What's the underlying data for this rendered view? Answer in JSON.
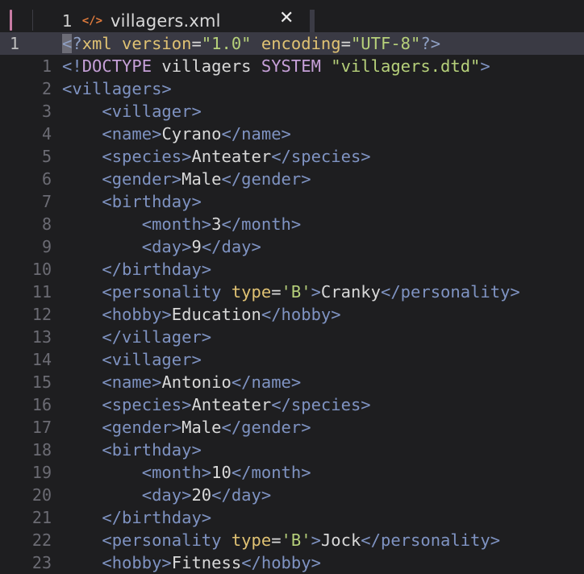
{
  "tab": {
    "number": "1",
    "icon": "</>",
    "filename": "villagers.xml",
    "close_glyph": "✕"
  },
  "editor": {
    "active_line_label": "1",
    "lines": [
      {
        "num": "1",
        "active": true,
        "tokens": [
          {
            "t": "t-pi",
            "v": "<?"
          },
          {
            "t": "t-attr",
            "v": "xml version"
          },
          {
            "t": "t-text",
            "v": "="
          },
          {
            "t": "t-str",
            "v": "\"1.0\""
          },
          {
            "t": "t-text",
            "v": " "
          },
          {
            "t": "t-attr",
            "v": "encoding"
          },
          {
            "t": "t-text",
            "v": "="
          },
          {
            "t": "t-str",
            "v": "\"UTF-8\""
          },
          {
            "t": "t-pi",
            "v": "?>"
          }
        ]
      },
      {
        "num": "1",
        "tokens": [
          {
            "t": "t-tag",
            "v": "<!"
          },
          {
            "t": "t-doctype",
            "v": "DOCTYPE"
          },
          {
            "t": "t-text",
            "v": " villagers "
          },
          {
            "t": "t-doctype",
            "v": "SYSTEM"
          },
          {
            "t": "t-text",
            "v": " "
          },
          {
            "t": "t-str",
            "v": "\"villagers.dtd\""
          },
          {
            "t": "t-tag",
            "v": ">"
          }
        ]
      },
      {
        "num": "2",
        "tokens": [
          {
            "t": "t-tag",
            "v": "<villagers>"
          }
        ]
      },
      {
        "num": "3",
        "tokens": [
          {
            "t": "t-text",
            "v": "    "
          },
          {
            "t": "t-tag",
            "v": "<villager>"
          }
        ]
      },
      {
        "num": "4",
        "tokens": [
          {
            "t": "t-text",
            "v": "    "
          },
          {
            "t": "t-tag",
            "v": "<name>"
          },
          {
            "t": "t-text",
            "v": "Cyrano"
          },
          {
            "t": "t-tag",
            "v": "</name>"
          }
        ]
      },
      {
        "num": "5",
        "tokens": [
          {
            "t": "t-text",
            "v": "    "
          },
          {
            "t": "t-tag",
            "v": "<species>"
          },
          {
            "t": "t-text",
            "v": "Anteater"
          },
          {
            "t": "t-tag",
            "v": "</species>"
          }
        ]
      },
      {
        "num": "6",
        "tokens": [
          {
            "t": "t-text",
            "v": "    "
          },
          {
            "t": "t-tag",
            "v": "<gender>"
          },
          {
            "t": "t-text",
            "v": "Male"
          },
          {
            "t": "t-tag",
            "v": "</gender>"
          }
        ]
      },
      {
        "num": "7",
        "tokens": [
          {
            "t": "t-text",
            "v": "    "
          },
          {
            "t": "t-tag",
            "v": "<birthday>"
          }
        ]
      },
      {
        "num": "8",
        "tokens": [
          {
            "t": "t-text",
            "v": "        "
          },
          {
            "t": "t-tag",
            "v": "<month>"
          },
          {
            "t": "t-text",
            "v": "3"
          },
          {
            "t": "t-tag",
            "v": "</month>"
          }
        ]
      },
      {
        "num": "9",
        "tokens": [
          {
            "t": "t-text",
            "v": "        "
          },
          {
            "t": "t-tag",
            "v": "<day>"
          },
          {
            "t": "t-text",
            "v": "9"
          },
          {
            "t": "t-tag",
            "v": "</day>"
          }
        ]
      },
      {
        "num": "10",
        "tokens": [
          {
            "t": "t-text",
            "v": "    "
          },
          {
            "t": "t-tag",
            "v": "</birthday>"
          }
        ]
      },
      {
        "num": "11",
        "tokens": [
          {
            "t": "t-text",
            "v": "    "
          },
          {
            "t": "t-tag",
            "v": "<personality "
          },
          {
            "t": "t-attr",
            "v": "type"
          },
          {
            "t": "t-text",
            "v": "="
          },
          {
            "t": "t-str",
            "v": "'B'"
          },
          {
            "t": "t-tag",
            "v": ">"
          },
          {
            "t": "t-text",
            "v": "Cranky"
          },
          {
            "t": "t-tag",
            "v": "</personality>"
          }
        ]
      },
      {
        "num": "12",
        "tokens": [
          {
            "t": "t-text",
            "v": "    "
          },
          {
            "t": "t-tag",
            "v": "<hobby>"
          },
          {
            "t": "t-text",
            "v": "Education"
          },
          {
            "t": "t-tag",
            "v": "</hobby>"
          }
        ]
      },
      {
        "num": "13",
        "tokens": [
          {
            "t": "t-text",
            "v": "    "
          },
          {
            "t": "t-tag",
            "v": "</villager>"
          }
        ]
      },
      {
        "num": "14",
        "tokens": [
          {
            "t": "t-text",
            "v": "    "
          },
          {
            "t": "t-tag",
            "v": "<villager>"
          }
        ]
      },
      {
        "num": "15",
        "tokens": [
          {
            "t": "t-text",
            "v": "    "
          },
          {
            "t": "t-tag",
            "v": "<name>"
          },
          {
            "t": "t-text",
            "v": "Antonio"
          },
          {
            "t": "t-tag",
            "v": "</name>"
          }
        ]
      },
      {
        "num": "16",
        "tokens": [
          {
            "t": "t-text",
            "v": "    "
          },
          {
            "t": "t-tag",
            "v": "<species>"
          },
          {
            "t": "t-text",
            "v": "Anteater"
          },
          {
            "t": "t-tag",
            "v": "</species>"
          }
        ]
      },
      {
        "num": "17",
        "tokens": [
          {
            "t": "t-text",
            "v": "    "
          },
          {
            "t": "t-tag",
            "v": "<gender>"
          },
          {
            "t": "t-text",
            "v": "Male"
          },
          {
            "t": "t-tag",
            "v": "</gender>"
          }
        ]
      },
      {
        "num": "18",
        "tokens": [
          {
            "t": "t-text",
            "v": "    "
          },
          {
            "t": "t-tag",
            "v": "<birthday>"
          }
        ]
      },
      {
        "num": "19",
        "tokens": [
          {
            "t": "t-text",
            "v": "        "
          },
          {
            "t": "t-tag",
            "v": "<month>"
          },
          {
            "t": "t-text",
            "v": "10"
          },
          {
            "t": "t-tag",
            "v": "</month>"
          }
        ]
      },
      {
        "num": "20",
        "tokens": [
          {
            "t": "t-text",
            "v": "        "
          },
          {
            "t": "t-tag",
            "v": "<day>"
          },
          {
            "t": "t-text",
            "v": "20"
          },
          {
            "t": "t-tag",
            "v": "</day>"
          }
        ]
      },
      {
        "num": "21",
        "tokens": [
          {
            "t": "t-text",
            "v": "    "
          },
          {
            "t": "t-tag",
            "v": "</birthday>"
          }
        ]
      },
      {
        "num": "22",
        "tokens": [
          {
            "t": "t-text",
            "v": "    "
          },
          {
            "t": "t-tag",
            "v": "<personality "
          },
          {
            "t": "t-attr",
            "v": "type"
          },
          {
            "t": "t-text",
            "v": "="
          },
          {
            "t": "t-str",
            "v": "'B'"
          },
          {
            "t": "t-tag",
            "v": ">"
          },
          {
            "t": "t-text",
            "v": "Jock"
          },
          {
            "t": "t-tag",
            "v": "</personality>"
          }
        ]
      },
      {
        "num": "23",
        "tokens": [
          {
            "t": "t-text",
            "v": "    "
          },
          {
            "t": "t-tag",
            "v": "<hobby>"
          },
          {
            "t": "t-text",
            "v": "Fitness"
          },
          {
            "t": "t-tag",
            "v": "</hobby>"
          }
        ]
      }
    ]
  },
  "colors": {
    "background": "#1e1e20",
    "active_line": "#3a3a44",
    "tag": "#7f93c2",
    "attribute": "#e0c273",
    "string": "#b6d07a",
    "doctype_keyword": "#c6a0d8",
    "text": "#d9d9d9",
    "line_number": "#6b6b73",
    "file_icon": "#e07b3c",
    "left_marker": "#c87ba3"
  }
}
